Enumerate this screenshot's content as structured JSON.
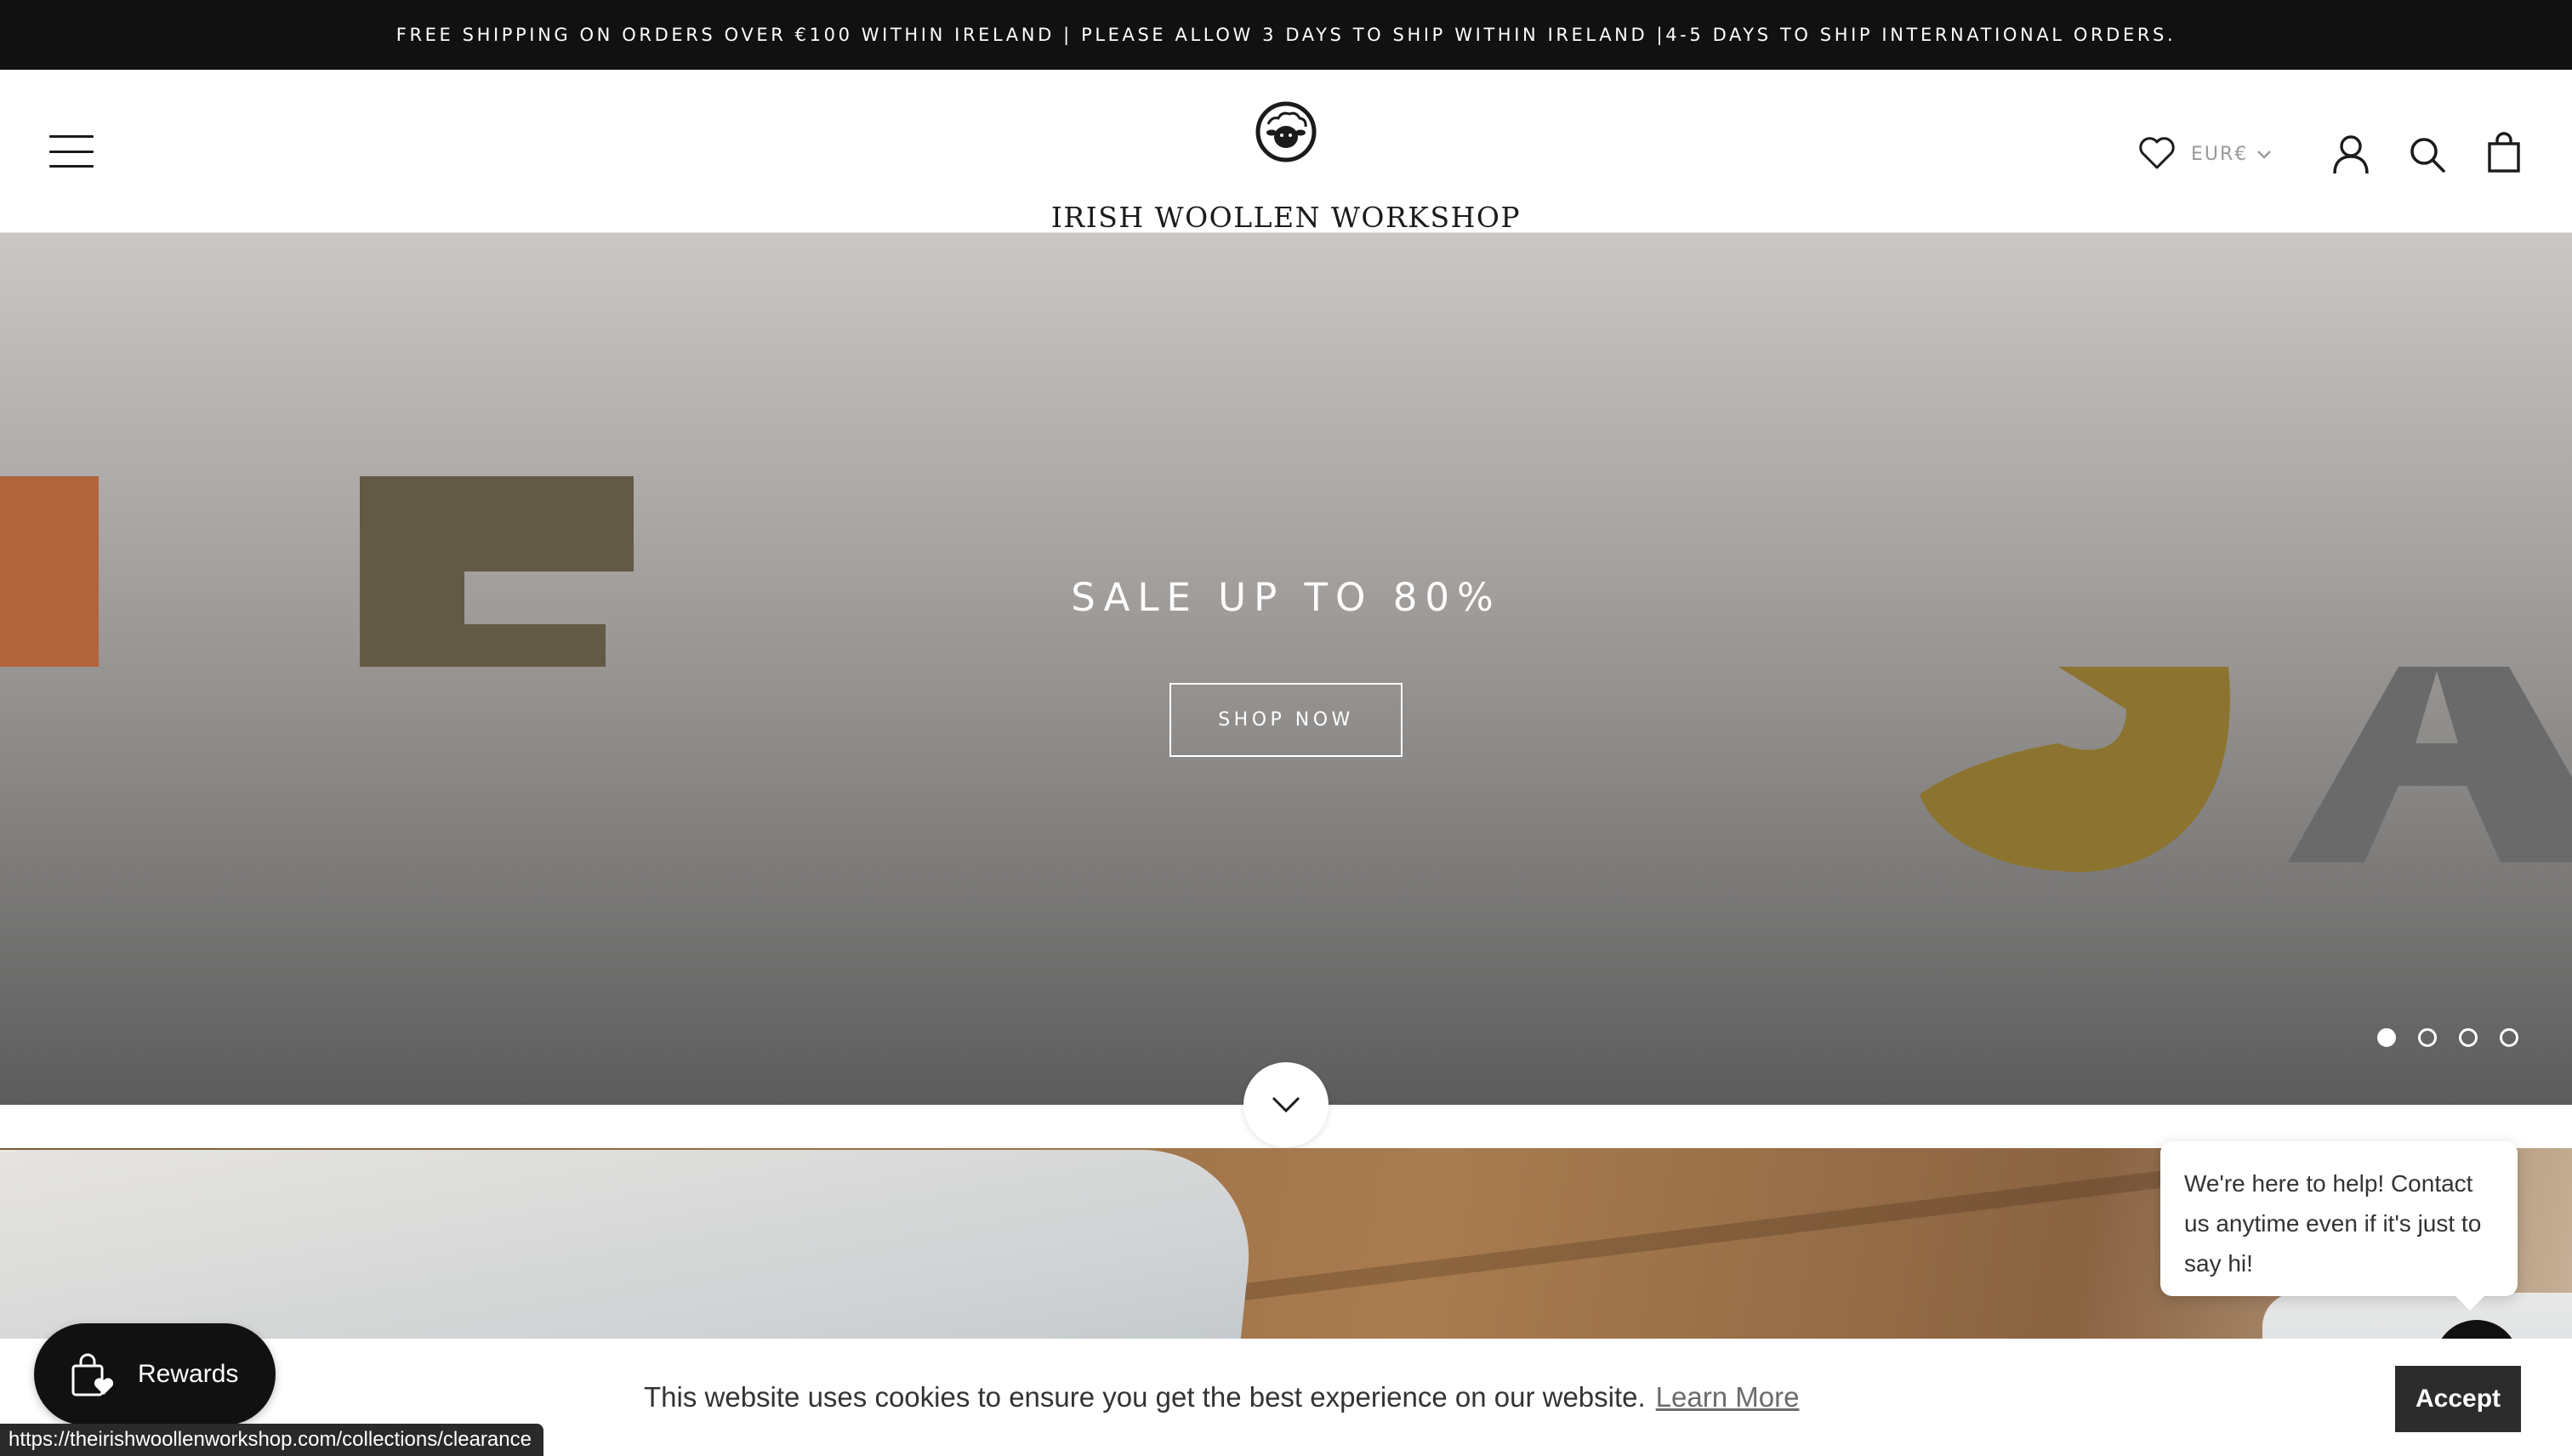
{
  "announcement": {
    "text": "FREE SHIPPING ON ORDERS OVER €100 WITHIN IRELAND | PLEASE ALLOW 3 DAYS TO SHIP WITHIN IRELAND |4-5 DAYS TO SHIP INTERNATIONAL ORDERS."
  },
  "header": {
    "logo_text": "IRISH WOOLLEN WORKSHOP",
    "currency": "EUR€",
    "icons": [
      "menu-icon",
      "heart-icon",
      "chevron-down-icon",
      "account-icon",
      "search-icon",
      "cart-icon"
    ]
  },
  "hero": {
    "title": "SALE UP TO 80%",
    "button_label": "SHOP NOW",
    "slides_count": 4,
    "active_slide": 1
  },
  "chat": {
    "message": "We're here to help! Contact us anytime even if it's just to say hi!"
  },
  "cookie": {
    "text": "This website uses cookies to ensure you get the best experience on our website.",
    "learn_more": "Learn More",
    "accept": "Accept"
  },
  "rewards": {
    "label": "Rewards"
  },
  "status_bar": {
    "url": "https://theirishwoollenworkshop.com/collections/clearance"
  },
  "colors": {
    "announcement_bg": "#111111",
    "accept_bg": "#2c2c2c",
    "rewards_bg": "#111111",
    "hero_top": "#cbc7c4",
    "hero_bottom": "#5c5c5c"
  }
}
